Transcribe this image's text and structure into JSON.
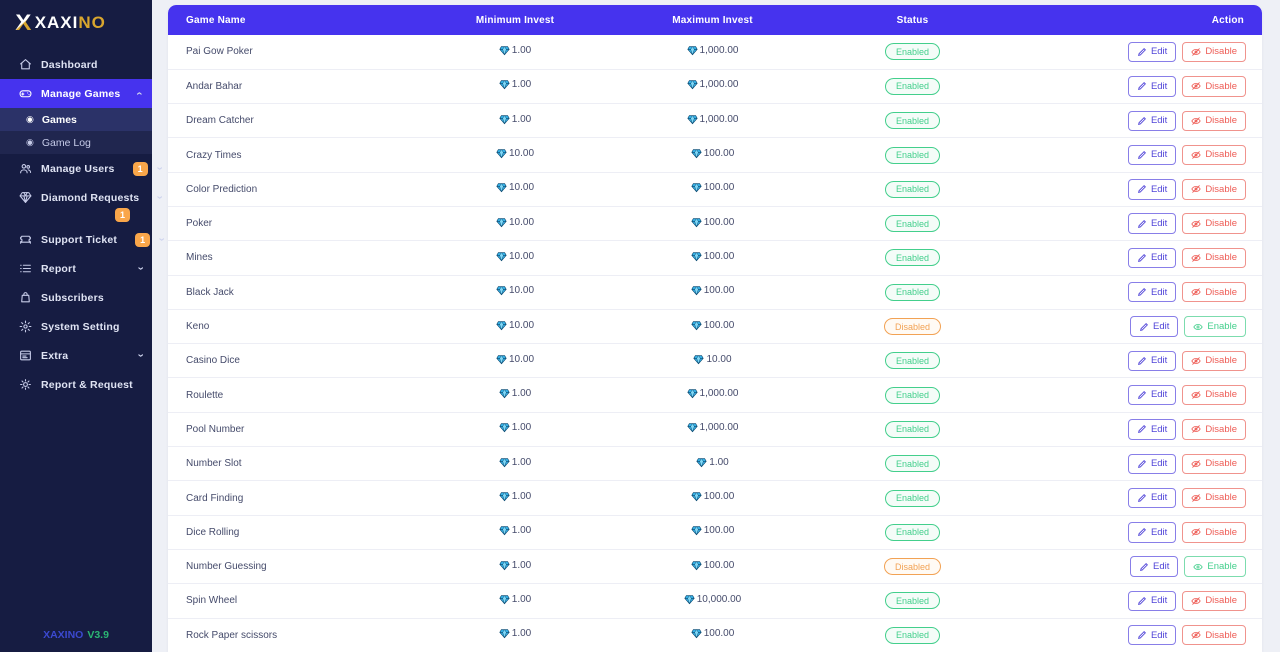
{
  "colors": {
    "accent": "#4633ee",
    "sidebar_bg": "#161c42",
    "content_bg": "#eef0f6",
    "gold": "#d9a62e",
    "badge": "#f9a64a",
    "success": "#43cf8c",
    "warning": "#f2a254",
    "danger": "#ee5c55",
    "edit": "#5044d8",
    "gem": "#2196d6"
  },
  "sidebar": {
    "logo": {
      "mark": "X",
      "brand_main": "XAXI",
      "brand_accent": "NO"
    },
    "items": [
      {
        "id": "dashboard",
        "label": "Dashboard",
        "icon": "home-icon"
      },
      {
        "id": "manage-games",
        "label": "Manage Games",
        "icon": "gamepad-icon",
        "active": true,
        "chevron": "up",
        "children": [
          {
            "id": "games",
            "label": "Games",
            "active": true
          },
          {
            "id": "game-log",
            "label": "Game Log",
            "active": false
          }
        ]
      },
      {
        "id": "manage-users",
        "label": "Manage Users",
        "icon": "users-icon",
        "badge": "1",
        "chevron": "down"
      },
      {
        "id": "diamond-requests",
        "label": "Diamond Requests",
        "icon": "diamond-icon",
        "badge": "1",
        "badge_wrapped": true,
        "chevron": "down"
      },
      {
        "id": "support-ticket",
        "label": "Support Ticket",
        "icon": "ticket-icon",
        "badge": "1",
        "chevron": "down"
      },
      {
        "id": "report",
        "label": "Report",
        "icon": "report-icon",
        "chevron": "down"
      },
      {
        "id": "subscribers",
        "label": "Subscribers",
        "icon": "bag-icon"
      },
      {
        "id": "system-setting",
        "label": "System Setting",
        "icon": "gear-icon"
      },
      {
        "id": "extra",
        "label": "Extra",
        "icon": "extra-icon",
        "chevron": "down"
      },
      {
        "id": "report-request",
        "label": "Report & Request",
        "icon": "cog-icon"
      }
    ],
    "footer": {
      "brand": "XAXINO",
      "version": "V3.9"
    }
  },
  "table": {
    "columns": [
      "Game Name",
      "Minimum Invest",
      "Maximum Invest",
      "Status",
      "Action"
    ],
    "labels": {
      "edit": "Edit",
      "disable": "Disable",
      "enable": "Enable",
      "status_enabled": "Enabled",
      "status_disabled": "Disabled"
    },
    "rows": [
      {
        "name": "Pai Gow Poker",
        "min": "1.00",
        "max": "1,000.00",
        "status": "Enabled"
      },
      {
        "name": "Andar Bahar",
        "min": "1.00",
        "max": "1,000.00",
        "status": "Enabled"
      },
      {
        "name": "Dream Catcher",
        "min": "1.00",
        "max": "1,000.00",
        "status": "Enabled"
      },
      {
        "name": "Crazy Times",
        "min": "10.00",
        "max": "100.00",
        "status": "Enabled"
      },
      {
        "name": "Color Prediction",
        "min": "10.00",
        "max": "100.00",
        "status": "Enabled"
      },
      {
        "name": "Poker",
        "min": "10.00",
        "max": "100.00",
        "status": "Enabled"
      },
      {
        "name": "Mines",
        "min": "10.00",
        "max": "100.00",
        "status": "Enabled"
      },
      {
        "name": "Black Jack",
        "min": "10.00",
        "max": "100.00",
        "status": "Enabled"
      },
      {
        "name": "Keno",
        "min": "10.00",
        "max": "100.00",
        "status": "Disabled"
      },
      {
        "name": "Casino Dice",
        "min": "10.00",
        "max": "10.00",
        "status": "Enabled"
      },
      {
        "name": "Roulette",
        "min": "1.00",
        "max": "1,000.00",
        "status": "Enabled"
      },
      {
        "name": "Pool Number",
        "min": "1.00",
        "max": "1,000.00",
        "status": "Enabled"
      },
      {
        "name": "Number Slot",
        "min": "1.00",
        "max": "1.00",
        "status": "Enabled"
      },
      {
        "name": "Card Finding",
        "min": "1.00",
        "max": "100.00",
        "status": "Enabled"
      },
      {
        "name": "Dice Rolling",
        "min": "1.00",
        "max": "100.00",
        "status": "Enabled"
      },
      {
        "name": "Number Guessing",
        "min": "1.00",
        "max": "100.00",
        "status": "Disabled"
      },
      {
        "name": "Spin Wheel",
        "min": "1.00",
        "max": "10,000.00",
        "status": "Enabled"
      },
      {
        "name": "Rock Paper scissors",
        "min": "1.00",
        "max": "100.00",
        "status": "Enabled"
      }
    ]
  }
}
